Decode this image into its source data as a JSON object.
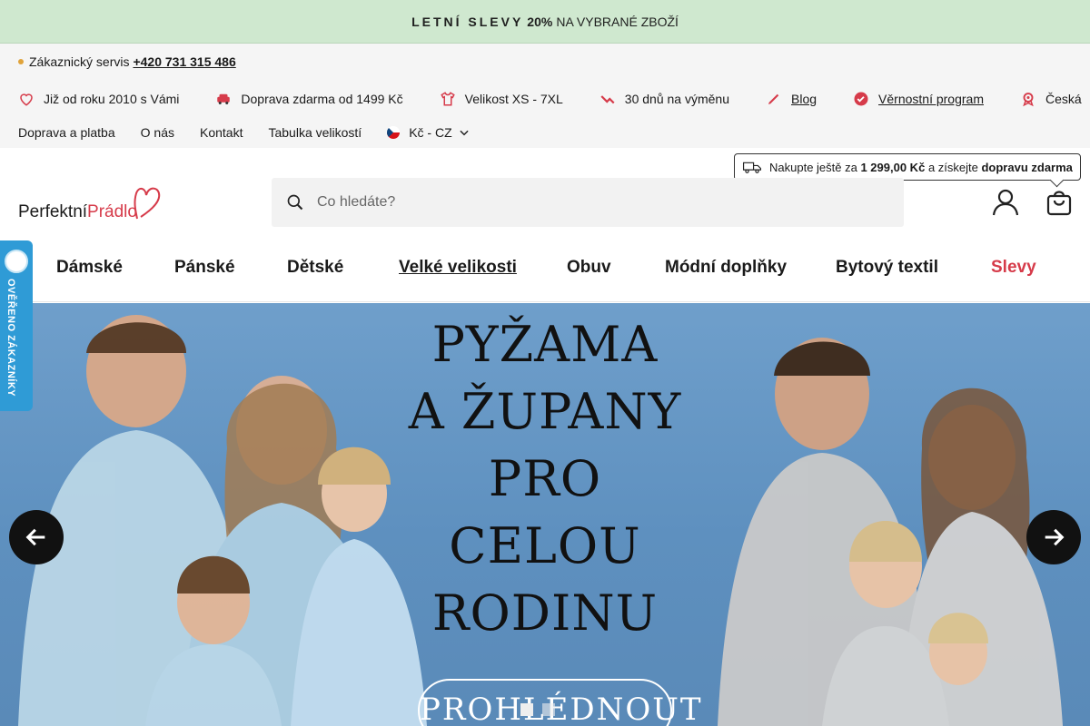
{
  "promo": {
    "caps": "LETNÍ SLEVY",
    "pct": "20%",
    "rest": "NA VYBRANÉ ZBOŽÍ"
  },
  "service": {
    "label": "Zákaznický servis",
    "phone": "+420 731 315 486"
  },
  "usps": [
    {
      "icon": "heart-icon",
      "text": "Již od roku 2010 s Vámi"
    },
    {
      "icon": "car-icon",
      "text": "Doprava zdarma od 1499 Kč"
    },
    {
      "icon": "tshirt-icon",
      "text": "Velikost XS - 7XL"
    },
    {
      "icon": "return-arrow-icon",
      "text": "30 dnů na výměnu"
    },
    {
      "icon": "pen-icon",
      "text": "Blog"
    },
    {
      "icon": "check-badge-icon",
      "text": "Věrnostní program"
    },
    {
      "icon": "award-icon",
      "text": "Česká"
    }
  ],
  "links": [
    "Doprava a platba",
    "O nás",
    "Kontakt",
    "Tabulka velikostí"
  ],
  "currency": "Kč - CZ",
  "freeship": {
    "pre": "Nakupte ještě za",
    "amount": "1 299,00 Kč",
    "mid": "a získejte",
    "bold": "dopravu zdarma"
  },
  "logo": {
    "part1": "Perfektní",
    "part2": "Prádlo"
  },
  "search": {
    "placeholder": "Co hledáte?"
  },
  "nav": [
    "Dámské",
    "Pánské",
    "Dětské",
    "Velké velikosti",
    "Obuv",
    "Módní doplňky",
    "Bytový textil",
    "Slevy"
  ],
  "badge": {
    "text": "OVĚŘENO ZÁKAZNÍKY"
  },
  "hero": {
    "lines": [
      "PYŽAMA",
      "A ŽUPANY",
      "PRO",
      "CELOU",
      "RODINU"
    ],
    "cta": "PROHLÉDNOUT"
  },
  "colors": {
    "promo_bg": "#cfe8cf",
    "accent_red": "#d63b4a",
    "badge_blue": "#2f9bd6",
    "hero_bg": "#6f9fcb"
  }
}
